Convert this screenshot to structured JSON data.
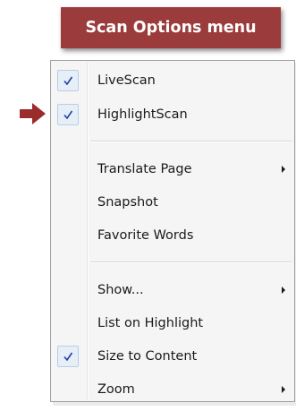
{
  "title": "Scan Options menu",
  "colors": {
    "banner_background": "#9b3b3b",
    "banner_text": "#ffffff",
    "arrow": "#9b2c2c",
    "check_mark": "#1f3fa8"
  },
  "menu": {
    "items": [
      {
        "label": "LiveScan",
        "checked": true,
        "submenu": false
      },
      {
        "label": "HighlightScan",
        "checked": true,
        "submenu": false
      },
      {
        "label": "Translate Page",
        "checked": false,
        "submenu": true
      },
      {
        "label": "Snapshot",
        "checked": false,
        "submenu": false
      },
      {
        "label": "Favorite Words",
        "checked": false,
        "submenu": false
      },
      {
        "label": "Show...",
        "checked": false,
        "submenu": true
      },
      {
        "label": "List on Highlight",
        "checked": false,
        "submenu": false
      },
      {
        "label": "Size to Content",
        "checked": true,
        "submenu": false
      },
      {
        "label": "Zoom",
        "checked": false,
        "submenu": true
      }
    ]
  },
  "annotation": {
    "pointer_icon": "right-arrow-icon",
    "points_to": "HighlightScan"
  }
}
